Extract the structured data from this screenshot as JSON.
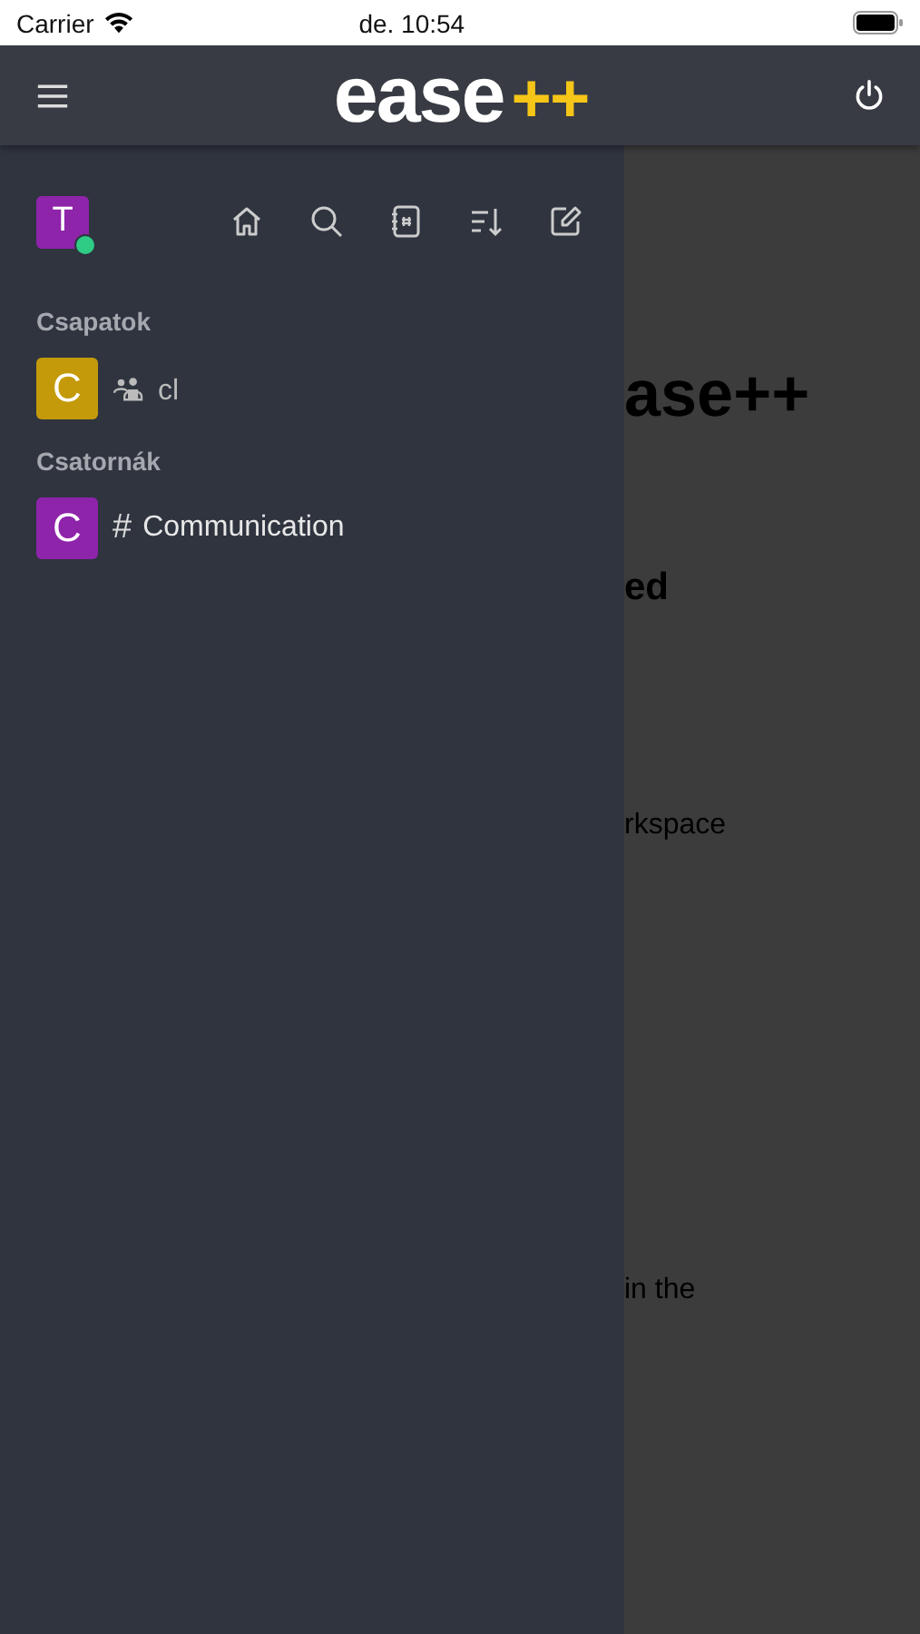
{
  "status_bar": {
    "carrier": "Carrier",
    "time": "de. 10:54"
  },
  "header": {
    "logo_text": "ease",
    "logo_accent": "++"
  },
  "background": {
    "texts": [
      {
        "kind": "title",
        "text": "ase++"
      },
      {
        "kind": "heading",
        "text": "ed"
      },
      {
        "kind": "body",
        "text": "rkspace"
      },
      {
        "kind": "body",
        "text": "in the"
      }
    ]
  },
  "drawer": {
    "user": {
      "initial": "T",
      "online": true
    },
    "sections": [
      {
        "title": "Csapatok",
        "items": [
          {
            "kind": "team",
            "initial": "C",
            "color": "#c49a0a",
            "name": "cl"
          }
        ]
      },
      {
        "title": "Csatornák",
        "items": [
          {
            "kind": "channel",
            "initial": "C",
            "color": "#8e24aa",
            "symbol": "#",
            "name": "Communication"
          }
        ]
      }
    ]
  }
}
